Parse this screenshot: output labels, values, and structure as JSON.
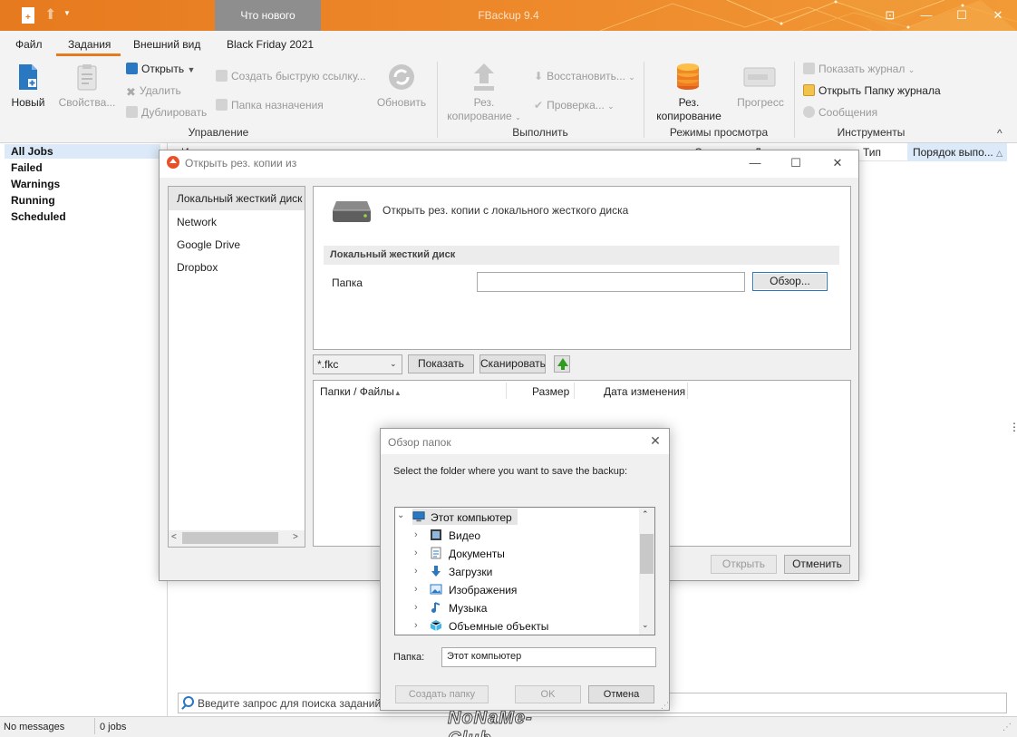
{
  "titlebar": {
    "whats_new": "Что нового",
    "app_title": "FBackup 9.4",
    "buttons": [
      "⊡",
      "—",
      "☐",
      "✕"
    ]
  },
  "menu": {
    "tabs": [
      "Файл",
      "Задания",
      "Внешний вид",
      "Black Friday 2021"
    ],
    "active": "Задания"
  },
  "ribbon": {
    "new": "Новый",
    "properties": "Свойства...",
    "open": "Открыть",
    "delete": "Удалить",
    "duplicate": "Дублировать",
    "quick_link": "Создать быструю ссылку...",
    "dest_folder": "Папка назначения",
    "refresh": "Обновить",
    "backup_line1": "Рез.",
    "backup_line2": "копирование",
    "restore": "Восстановить...",
    "check": "Проверка...",
    "view_backup_line1": "Рез.",
    "view_backup_line2": "копирование",
    "progress": "Прогресс",
    "show_log": "Показать журнал",
    "open_log_folder": "Открыть Папку журнала",
    "messages": "Сообщения",
    "groups": [
      "Управление",
      "Выполнить",
      "Режимы просмотра",
      "Инструменты"
    ],
    "collapse": "^"
  },
  "jobs": {
    "items": [
      "All Jobs",
      "Failed",
      "Warnings",
      "Running",
      "Scheduled"
    ],
    "selected": "All Jobs"
  },
  "list_header": {
    "col1": "И",
    "col2": "С",
    "col3": "Д",
    "type": "Тип",
    "order": "Порядок выпо...",
    "sort_mark": "△"
  },
  "search": {
    "placeholder": "Введите запрос для поиска заданий р"
  },
  "status": {
    "messages": "No messages",
    "jobs": "0 jobs",
    "grip": "⋰"
  },
  "watermark": "NoNaMe-Club",
  "right_dots": "⋮",
  "dialog_open": {
    "title": "Открыть рез. копии из",
    "controls": [
      "—",
      "☐",
      "✕"
    ],
    "sources": [
      "Локальный жесткий диск",
      "Network",
      "Google Drive",
      "Dropbox"
    ],
    "selected": "Локальный жесткий диск",
    "scroll_left": "<",
    "scroll_right": ">",
    "heading": "Открыть рез. копии с локального жесткого диска",
    "section": "Локальный жесткий диск",
    "folder_label": "Папка",
    "folder_value": "",
    "browse": "Обзор...",
    "filter": "*.fkc",
    "filter_arrow": "⌄",
    "show": "Показать",
    "scan": "Сканировать",
    "columns": [
      "Папки / Файлы",
      "Размер",
      "Дата изменения"
    ],
    "sort_arrow": "▲",
    "open_btn": "Открыть",
    "cancel_btn": "Отменить"
  },
  "dialog_browse": {
    "title": "Обзор папок",
    "close": "✕",
    "prompt": "Select the folder where you want to save the backup:",
    "tree_root": "Этот компьютер",
    "tree_items": [
      "Видео",
      "Документы",
      "Загрузки",
      "Изображения",
      "Музыка",
      "Объемные объекты"
    ],
    "expand_open": "⌄",
    "expand_closed": "›",
    "scroll_up": "⌃",
    "scroll_down": "⌄",
    "folder_label": "Папка:",
    "folder_value": "Этот компьютер",
    "new_folder": "Создать папку",
    "ok": "OK",
    "cancel": "Отмена",
    "grip": "⋰"
  },
  "colors": {
    "accent": "#e67a1e",
    "selection": "#dbe9f8",
    "focus": "#2b78c2"
  }
}
